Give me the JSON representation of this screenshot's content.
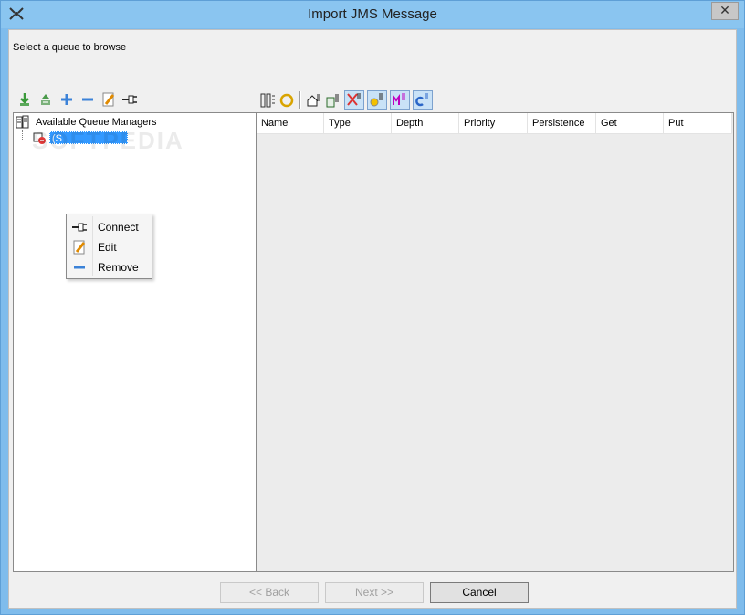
{
  "window": {
    "title": "Import JMS Message",
    "close_label": "✕"
  },
  "prompt": "Select a queue to browse",
  "toolbar_left": [
    {
      "name": "import-icon"
    },
    {
      "name": "export-icon"
    },
    {
      "name": "add-icon"
    },
    {
      "name": "remove-icon"
    },
    {
      "name": "edit-icon"
    },
    {
      "name": "connect-icon"
    }
  ],
  "toolbar_right": [
    {
      "name": "columns-icon",
      "toggled": false
    },
    {
      "name": "refresh-icon",
      "toggled": false
    },
    {
      "name": "local-queue-icon",
      "toggled": false
    },
    {
      "name": "remote-queue-icon",
      "toggled": false
    },
    {
      "name": "alias-queue-icon",
      "toggled": true
    },
    {
      "name": "model-queue-icon",
      "toggled": true
    },
    {
      "name": "system-queue-icon",
      "toggled": true
    },
    {
      "name": "cluster-queue-icon",
      "toggled": true
    }
  ],
  "tree": {
    "root_label": "Available Queue Managers",
    "selected_label": "(S"
  },
  "context_menu": {
    "items": [
      {
        "label": "Connect",
        "icon": "connect-icon"
      },
      {
        "label": "Edit",
        "icon": "edit-icon"
      },
      {
        "label": "Remove",
        "icon": "remove-icon"
      }
    ]
  },
  "table": {
    "columns": [
      "Name",
      "Type",
      "Depth",
      "Priority",
      "Persistence",
      "Get",
      "Put"
    ],
    "rows": []
  },
  "buttons": {
    "back": "<< Back",
    "next": "Next >>",
    "cancel": "Cancel"
  },
  "watermark": "SOFTPEDIA"
}
